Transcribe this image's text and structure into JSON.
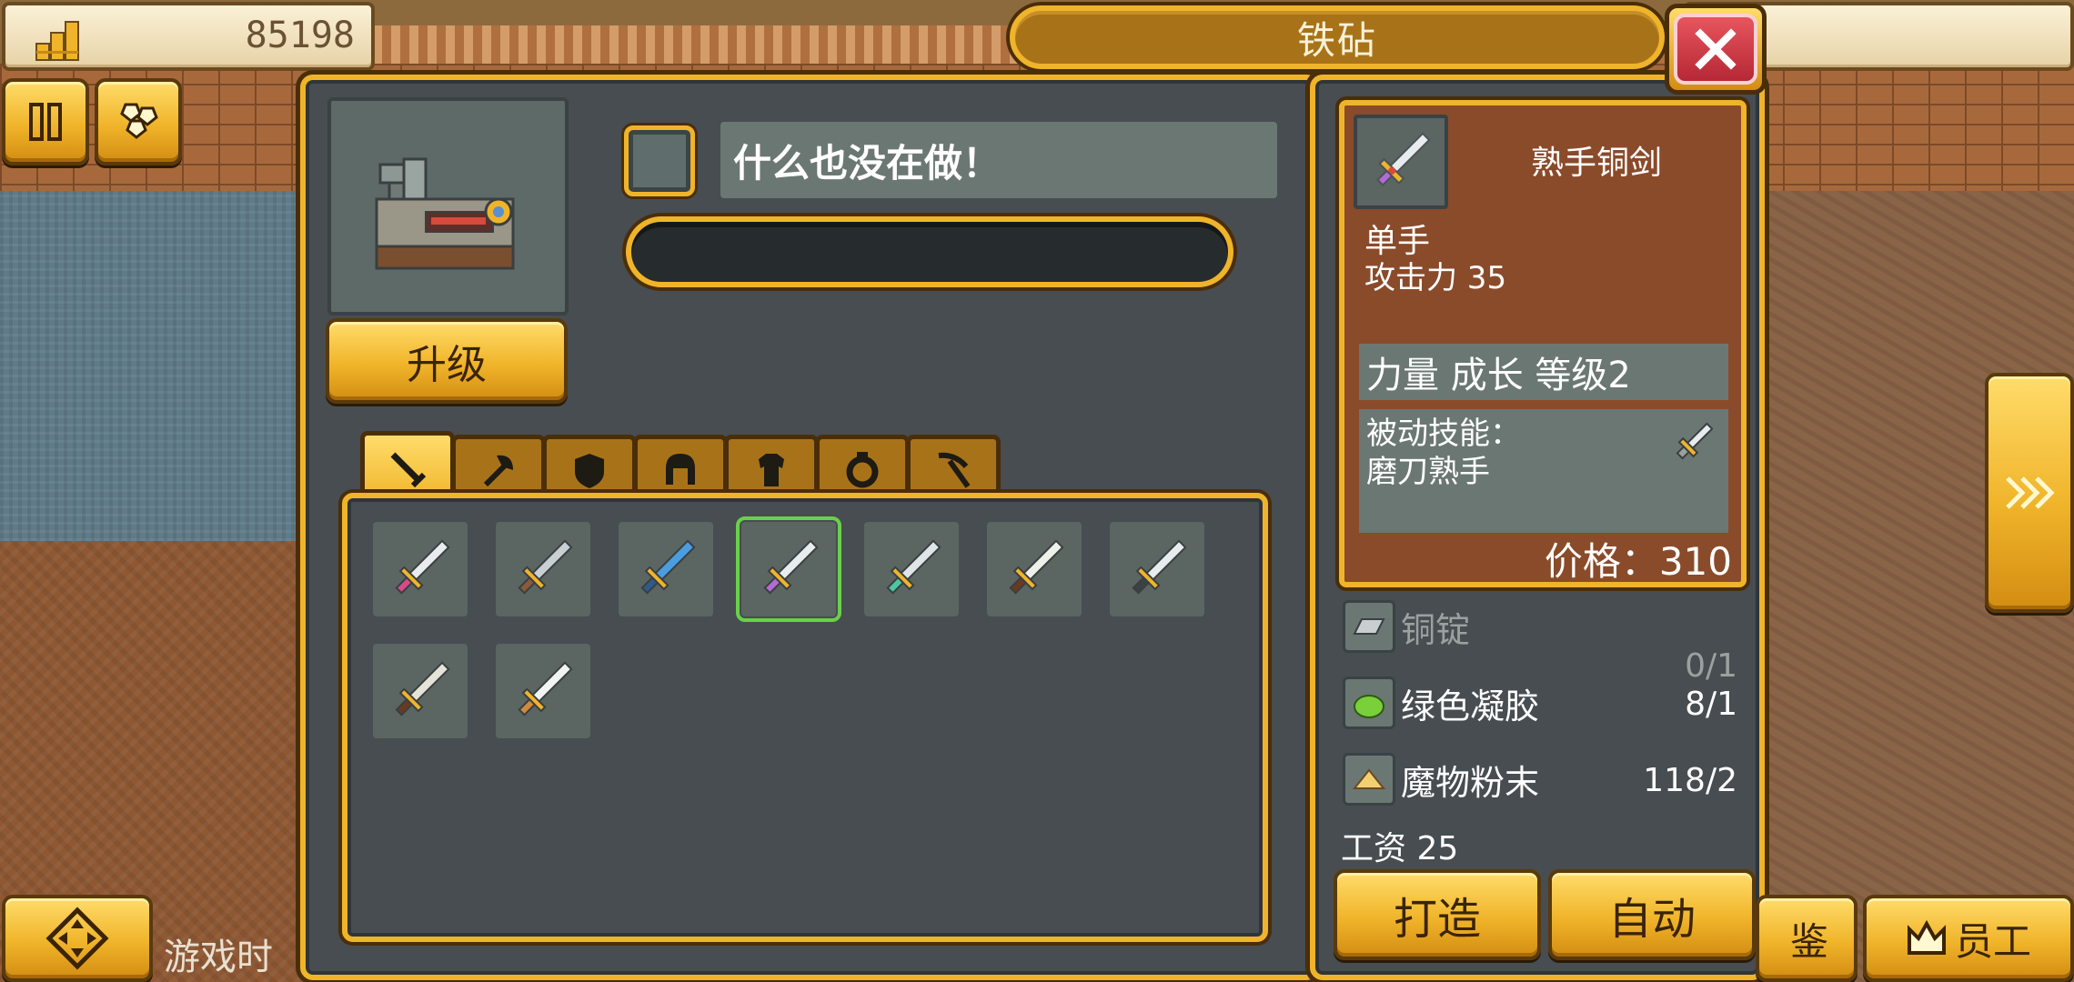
{
  "hud": {
    "money": "85198",
    "game_time_label": "游戏时"
  },
  "dialog": {
    "title": "铁砧",
    "status_text": "什么也没在做！",
    "progress": 0,
    "upgrade_label": "升级"
  },
  "tabs": [
    {
      "icon": "sword-icon",
      "active": true
    },
    {
      "icon": "axe-icon",
      "active": false
    },
    {
      "icon": "shield-icon",
      "active": false
    },
    {
      "icon": "helmet-icon",
      "active": false
    },
    {
      "icon": "armor-icon",
      "active": false
    },
    {
      "icon": "ring-icon",
      "active": false
    },
    {
      "icon": "pickaxe-icon",
      "active": false
    }
  ],
  "recipes": [
    {
      "icon": "dagger-pink-hilt-icon",
      "selected": false
    },
    {
      "icon": "curved-knife-icon",
      "selected": false
    },
    {
      "icon": "crystal-blade-icon",
      "selected": false
    },
    {
      "icon": "proficient-copper-sword-icon",
      "selected": true
    },
    {
      "icon": "green-gem-knife-icon",
      "selected": false
    },
    {
      "icon": "bone-blade-icon",
      "selected": false
    },
    {
      "icon": "iron-longsword-icon",
      "selected": false
    },
    {
      "icon": "short-blade-icon",
      "selected": false
    },
    {
      "icon": "silver-broadsword-icon",
      "selected": false
    }
  ],
  "item": {
    "name": "熟手铜剑",
    "hand": "单手",
    "attack": "攻击力 35",
    "growth": "力量 成长 等级2",
    "skill_title": "被动技能：",
    "skill_name": "磨刀熟手",
    "price": "价格：310"
  },
  "materials": [
    {
      "name": "铜锭",
      "count": "0/1",
      "icon": "copper-ingot-icon",
      "available": false
    },
    {
      "name": "绿色凝胶",
      "count": "8/1",
      "icon": "green-gel-icon",
      "available": true
    },
    {
      "name": "魔物粉末",
      "count": "118/2",
      "icon": "monster-powder-icon",
      "available": true
    }
  ],
  "wage": "工资 25",
  "buttons": {
    "forge": "打造",
    "auto": "自动",
    "appraise": "鉴",
    "staff": "员工"
  },
  "colors": {
    "gold": "#f0b42a",
    "panel": "#474d51",
    "card": "#8a4b2b",
    "selected_outline": "#6ad04a",
    "close_red": "#d33a45"
  }
}
